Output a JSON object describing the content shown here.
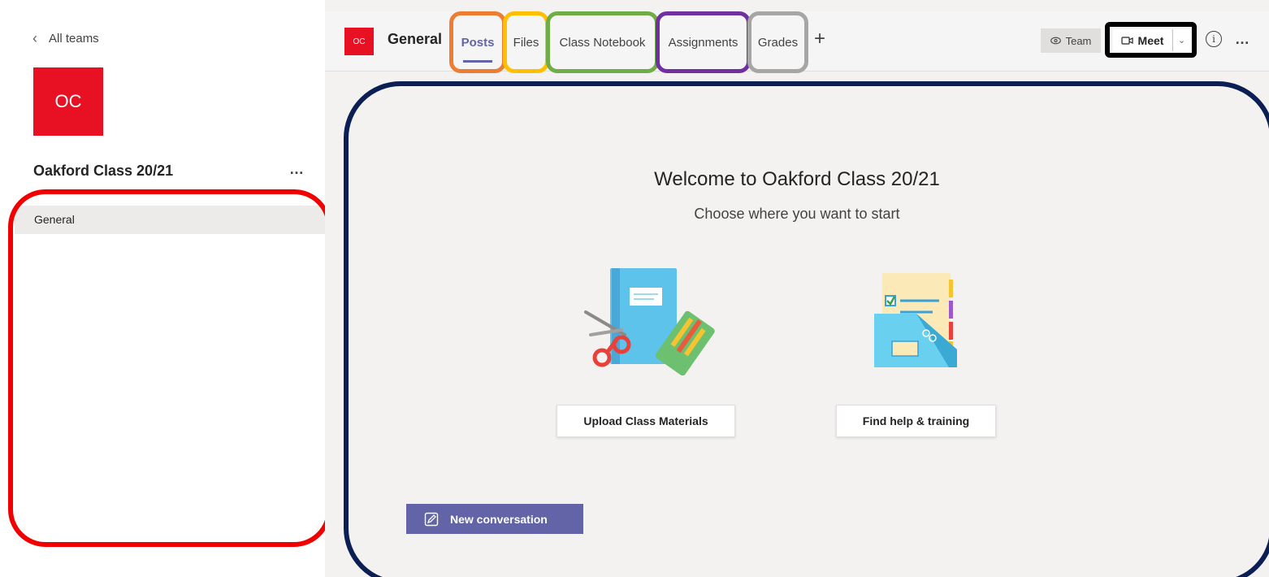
{
  "nav": {
    "back_label": "All teams"
  },
  "team": {
    "avatar_initials": "OC",
    "name": "Oakford Class 20/21",
    "more": "…"
  },
  "channels": [
    {
      "label": "General"
    }
  ],
  "header": {
    "channel_avatar": "OC",
    "channel_title": "General",
    "tabs": [
      {
        "label": "Posts",
        "active": true
      },
      {
        "label": "Files"
      },
      {
        "label": "Class Notebook"
      },
      {
        "label": "Assignments"
      },
      {
        "label": "Grades"
      }
    ],
    "add_tab": "+",
    "team_button": "Team",
    "meet_button": "Meet",
    "more": "…"
  },
  "welcome": {
    "title": "Welcome to Oakford Class 20/21",
    "subtitle": "Choose where you want to start",
    "upload_button": "Upload Class Materials",
    "help_button": "Find help & training"
  },
  "compose": {
    "new_conversation": "New conversation"
  },
  "colors": {
    "brand": "#6264a7",
    "team_avatar": "#e81123",
    "highlight_channels": "#f00000",
    "highlight_content": "#0b1f55",
    "highlight_posts": "#ed7d31",
    "highlight_files": "#ffc000",
    "highlight_notebook": "#70ad47",
    "highlight_assignments": "#7030a0",
    "highlight_grades": "#a6a6a6",
    "highlight_meet": "#000000"
  }
}
